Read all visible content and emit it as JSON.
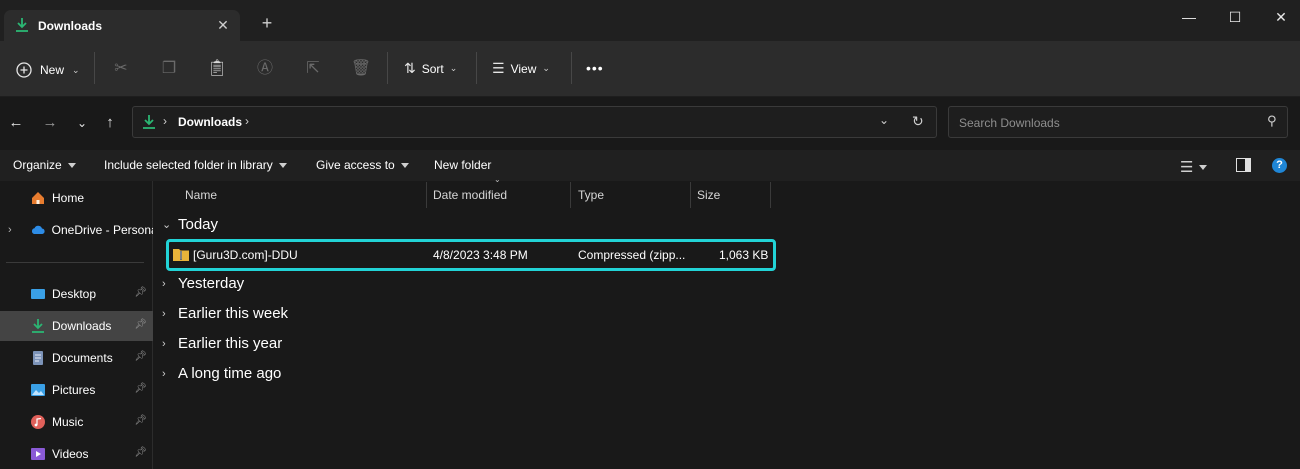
{
  "window": {
    "tab_title": "Downloads",
    "tab_close": "✕",
    "new_tab": "+",
    "minimize": "—",
    "maximize": "☐",
    "close": "✕"
  },
  "command_bar": {
    "new_label": "New",
    "sort_label": "Sort",
    "view_label": "View",
    "more": "•••"
  },
  "address": {
    "breadcrumb": [
      "Downloads"
    ],
    "search_placeholder": "Search Downloads"
  },
  "ribbon": {
    "organize": "Organize",
    "include": "Include selected folder in library",
    "give_access": "Give access to",
    "new_folder": "New folder",
    "help": "?"
  },
  "nav": {
    "home": "Home",
    "onedrive": "OneDrive - Personal",
    "pinned": [
      "Desktop",
      "Downloads",
      "Documents",
      "Pictures",
      "Music",
      "Videos"
    ],
    "selected": "Downloads"
  },
  "columns": {
    "name": "Name",
    "date": "Date modified",
    "type": "Type",
    "size": "Size"
  },
  "groups": {
    "today": "Today",
    "others": [
      "Yesterday",
      "Earlier this week",
      "Earlier this year",
      "A long time ago"
    ]
  },
  "files": [
    {
      "name": "[Guru3D.com]-DDU",
      "date": "4/8/2023 3:48 PM",
      "type": "Compressed (zipp...",
      "size": "1,063 KB"
    }
  ],
  "colors": {
    "accent": "#22d3d6",
    "download_icon": "#2bb673",
    "folder": "#e8b33a"
  }
}
